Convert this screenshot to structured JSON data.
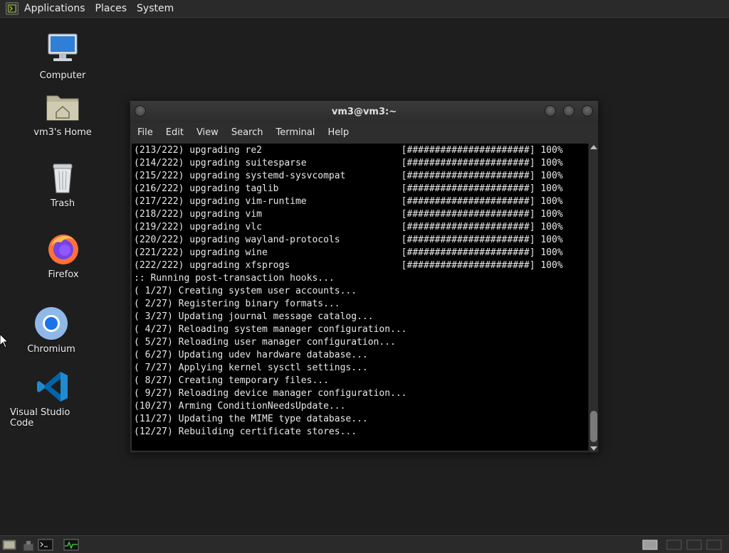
{
  "top_panel": {
    "menus": [
      "Applications",
      "Places",
      "System"
    ]
  },
  "desktop": {
    "icons": [
      {
        "label": "Computer",
        "icon": "computer-icon"
      },
      {
        "label": "vm3's Home",
        "icon": "home-folder-icon"
      },
      {
        "label": "Trash",
        "icon": "trash-icon"
      },
      {
        "label": "Firefox",
        "icon": "firefox-icon"
      },
      {
        "label": "Chromium",
        "icon": "chromium-icon"
      },
      {
        "label": "Visual Studio Code",
        "icon": "vscode-icon"
      }
    ]
  },
  "terminal": {
    "title": "vm3@vm3:~",
    "menu": [
      "File",
      "Edit",
      "View",
      "Search",
      "Terminal",
      "Help"
    ],
    "lines": [
      "(213/222) upgrading re2                         [######################] 100%",
      "(214/222) upgrading suitesparse                 [######################] 100%",
      "(215/222) upgrading systemd-sysvcompat          [######################] 100%",
      "(216/222) upgrading taglib                      [######################] 100%",
      "(217/222) upgrading vim-runtime                 [######################] 100%",
      "(218/222) upgrading vim                         [######################] 100%",
      "(219/222) upgrading vlc                         [######################] 100%",
      "(220/222) upgrading wayland-protocols           [######################] 100%",
      "(221/222) upgrading wine                        [######################] 100%",
      "(222/222) upgrading xfsprogs                    [######################] 100%",
      ":: Running post-transaction hooks...",
      "( 1/27) Creating system user accounts...",
      "( 2/27) Registering binary formats...",
      "( 3/27) Updating journal message catalog...",
      "( 4/27) Reloading system manager configuration...",
      "( 5/27) Reloading user manager configuration...",
      "( 6/27) Updating udev hardware database...",
      "( 7/27) Applying kernel sysctl settings...",
      "( 8/27) Creating temporary files...",
      "( 9/27) Reloading device manager configuration...",
      "(10/27) Arming ConditionNeedsUpdate...",
      "(11/27) Updating the MIME type database...",
      "(12/27) Rebuilding certificate stores..."
    ]
  },
  "colors": {
    "desktop_bg": "#1e1e1e",
    "panel_bg": "#2a2a2a",
    "terminal_bg": "#000000",
    "terminal_fg": "#e8e8e8"
  }
}
